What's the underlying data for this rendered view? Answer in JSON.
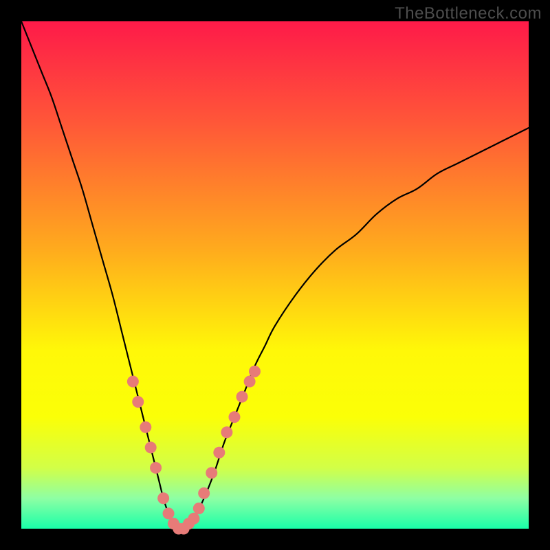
{
  "watermark": {
    "text": "TheBottleneck.com"
  },
  "colors": {
    "frame": "#000000",
    "curve": "#000000",
    "markers": "#e77b78",
    "gradient_stops": [
      {
        "pct": 0,
        "color": "#fe1a49"
      },
      {
        "pct": 20,
        "color": "#ff5738"
      },
      {
        "pct": 45,
        "color": "#ffab1d"
      },
      {
        "pct": 65,
        "color": "#fff808"
      },
      {
        "pct": 78,
        "color": "#fbff07"
      },
      {
        "pct": 88,
        "color": "#d2ff47"
      },
      {
        "pct": 94,
        "color": "#8effa4"
      },
      {
        "pct": 100,
        "color": "#19ffa8"
      }
    ]
  },
  "chart_data": {
    "type": "line",
    "title": "",
    "xlabel": "",
    "ylabel": "",
    "x_range": [
      0,
      100
    ],
    "y_range": [
      0,
      100
    ],
    "legend": false,
    "grid": false,
    "series": [
      {
        "name": "bottleneck-curve",
        "x": [
          0,
          2,
          4,
          6,
          8,
          10,
          12,
          14,
          16,
          18,
          20,
          22,
          24,
          25,
          26,
          27,
          28,
          29,
          30,
          31,
          32,
          34,
          36,
          38,
          40,
          42,
          44,
          46,
          48,
          50,
          54,
          58,
          62,
          66,
          70,
          74,
          78,
          82,
          86,
          90,
          94,
          98,
          100
        ],
        "y": [
          100,
          95,
          90,
          85,
          79,
          73,
          67,
          60,
          53,
          46,
          38,
          30,
          22,
          18,
          14,
          10,
          6,
          3,
          1,
          0,
          0,
          2,
          6,
          11,
          17,
          22,
          27,
          32,
          36,
          40,
          46,
          51,
          55,
          58,
          62,
          65,
          67,
          70,
          72,
          74,
          76,
          78,
          79
        ]
      }
    ],
    "markers": {
      "name": "highlight-points",
      "points": [
        {
          "x": 22.0,
          "y": 29
        },
        {
          "x": 23.0,
          "y": 25
        },
        {
          "x": 24.5,
          "y": 20
        },
        {
          "x": 25.5,
          "y": 16
        },
        {
          "x": 26.5,
          "y": 12
        },
        {
          "x": 28.0,
          "y": 6
        },
        {
          "x": 29.0,
          "y": 3
        },
        {
          "x": 30.0,
          "y": 1
        },
        {
          "x": 31.0,
          "y": 0
        },
        {
          "x": 32.0,
          "y": 0
        },
        {
          "x": 33.0,
          "y": 1
        },
        {
          "x": 34.0,
          "y": 2
        },
        {
          "x": 35.0,
          "y": 4
        },
        {
          "x": 36.0,
          "y": 7
        },
        {
          "x": 37.5,
          "y": 11
        },
        {
          "x": 39.0,
          "y": 15
        },
        {
          "x": 40.5,
          "y": 19
        },
        {
          "x": 42.0,
          "y": 22
        },
        {
          "x": 43.5,
          "y": 26
        },
        {
          "x": 45.0,
          "y": 29
        },
        {
          "x": 46.0,
          "y": 31
        }
      ]
    }
  }
}
